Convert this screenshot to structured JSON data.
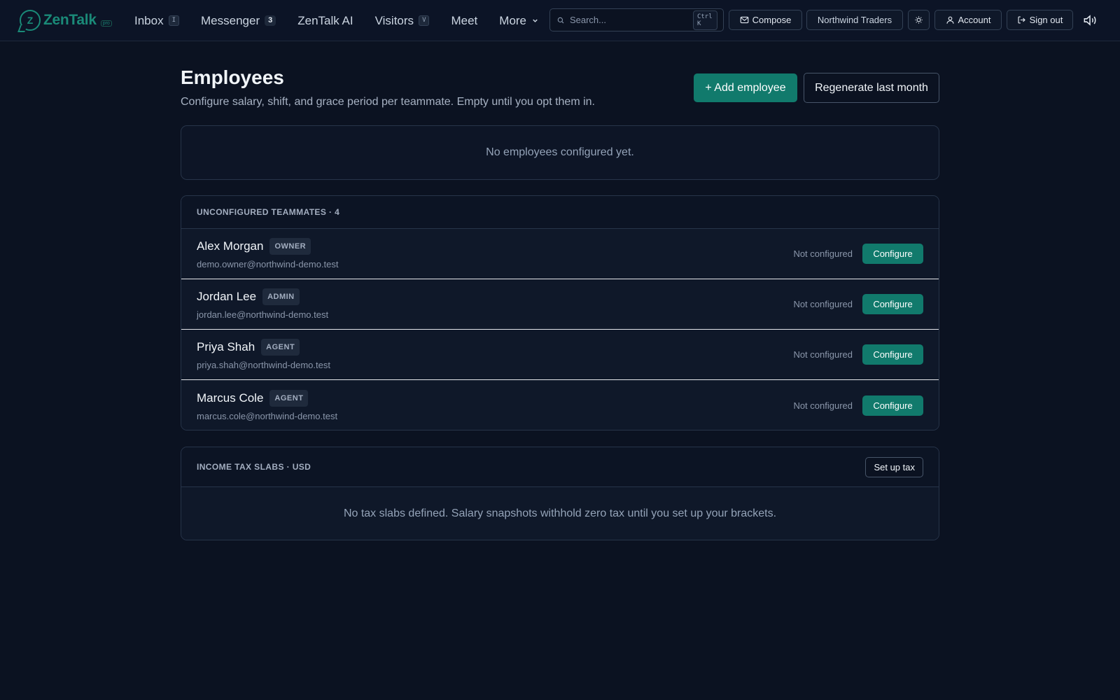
{
  "app": {
    "name": "ZenTalk",
    "logo_badge": "pro"
  },
  "nav": {
    "items": [
      {
        "label": "Inbox",
        "kbd": "I"
      },
      {
        "label": "Messenger",
        "count": "3"
      },
      {
        "label": "ZenTalk AI"
      },
      {
        "label": "Visitors",
        "kbd": "V"
      },
      {
        "label": "Meet"
      },
      {
        "label": "More"
      }
    ],
    "search_placeholder": "Search...",
    "search_shortcut": "Ctrl K",
    "compose_label": "Compose",
    "workspace_label": "Northwind Traders",
    "account_label": "Account",
    "signout_label": "Sign out"
  },
  "page": {
    "title": "Employees",
    "subtitle": "Configure salary, shift, and grace period per teammate. Empty until you opt them in.",
    "add_button": "+ Add employee",
    "regenerate_button": "Regenerate last month",
    "empty_state": "No employees configured yet."
  },
  "teammates": {
    "header": "UNCONFIGURED TEAMMATES · 4",
    "configure_label": "Configure",
    "rows": [
      {
        "name": "Alex Morgan",
        "role": "OWNER",
        "email": "demo.owner@northwind-demo.test",
        "status": "Not configured"
      },
      {
        "name": "Jordan Lee",
        "role": "ADMIN",
        "email": "jordan.lee@northwind-demo.test",
        "status": "Not configured"
      },
      {
        "name": "Priya Shah",
        "role": "AGENT",
        "email": "priya.shah@northwind-demo.test",
        "status": "Not configured"
      },
      {
        "name": "Marcus Cole",
        "role": "AGENT",
        "email": "marcus.cole@northwind-demo.test",
        "status": "Not configured"
      }
    ]
  },
  "tax": {
    "header": "INCOME TAX SLABS · USD",
    "setup_button": "Set up tax",
    "empty_state": "No tax slabs defined. Salary snapshots withhold zero tax until you set up your brackets."
  },
  "colors": {
    "background": "#0b1221",
    "accent": "#117a6c",
    "brand": "#1a8a78"
  }
}
